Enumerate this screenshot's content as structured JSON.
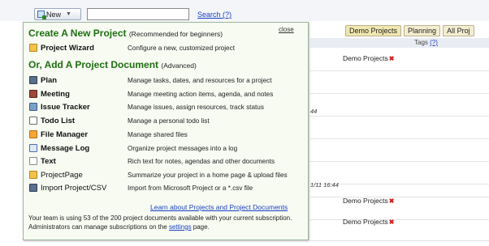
{
  "toolbar": {
    "new_label": "New",
    "search_value": "",
    "search_link": "Search (?)"
  },
  "tabs": [
    "Demo Projects",
    "Planning",
    "All Proj"
  ],
  "tags_header": {
    "label": "Tags",
    "help": "(?)"
  },
  "background_rows": [
    {
      "tag": "Demo Projects"
    },
    {
      "date": "44"
    },
    {
      "date": "1/11 16:44"
    },
    {
      "tag": "Demo Projects"
    },
    {
      "tag": "Demo Projects"
    }
  ],
  "popup": {
    "close_label": "close",
    "create_heading": "Create A New Project",
    "create_sub": "(Recommended for beginners)",
    "add_heading": "Or, Add A Project Document",
    "add_sub": "(Advanced)",
    "wizard": {
      "name": "Project Wizard",
      "desc": "Configure a new, customized project",
      "icon": "wizard-icon"
    },
    "documents": [
      {
        "name": "Plan",
        "desc": "Manage tasks, dates, and resources for a project",
        "icon": "plan-icon"
      },
      {
        "name": "Meeting",
        "desc": "Manage meeting action items, agenda, and notes",
        "icon": "meeting-icon"
      },
      {
        "name": "Issue Tracker",
        "desc": "Manage issues, assign resources, track status",
        "icon": "issue-tracker-icon"
      },
      {
        "name": "Todo List",
        "desc": "Manage a personal todo list",
        "icon": "todo-list-icon"
      },
      {
        "name": "File Manager",
        "desc": "Manage shared files",
        "icon": "file-manager-icon"
      },
      {
        "name": "Message Log",
        "desc": "Organize project messages into a log",
        "icon": "message-log-icon"
      },
      {
        "name": "Text",
        "desc": "Rich text for notes, agendas and other documents",
        "icon": "text-icon"
      },
      {
        "name": "ProjectPage",
        "desc": "Summarize your project in a home page & upload files",
        "icon": "project-page-icon"
      },
      {
        "name": "Import Project/CSV",
        "desc": "Import from Microsoft Project or a *.csv file",
        "icon": "import-csv-icon"
      }
    ],
    "learn_link": "Learn about Projects and Project Documents",
    "footer_text_1": "Your team is using 53 of the 200 project documents available with your current subscription. Administrators can manage subscriptions on the ",
    "footer_link": "settings",
    "footer_text_2": " page."
  }
}
